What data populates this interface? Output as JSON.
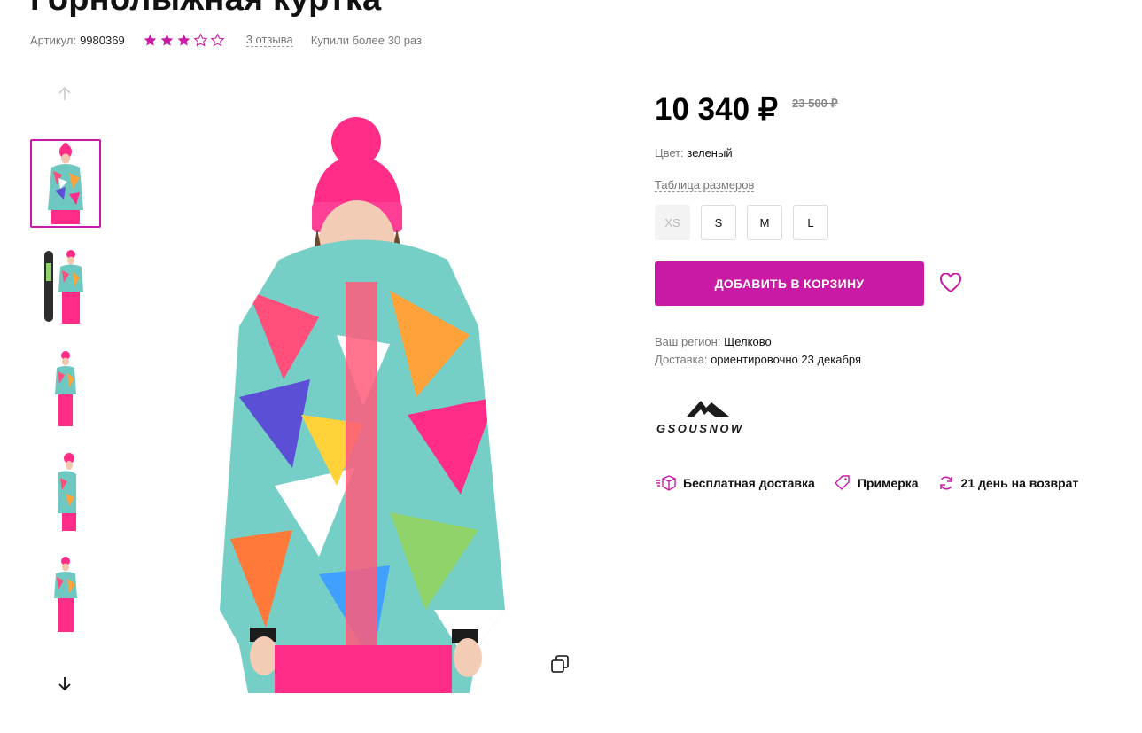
{
  "product": {
    "title": "Горнолыжная куртка",
    "sku_label": "Артикул:",
    "sku_value": "9980369",
    "rating": 3,
    "rating_max": 5,
    "reviews_link": "3 отзыва",
    "bought_text": "Купили более 30 раз"
  },
  "gallery": {
    "thumbnail_count": 5,
    "active_index": 0
  },
  "pricing": {
    "price": "10 340 ₽",
    "old_price": "23 500 ₽"
  },
  "color": {
    "label": "Цвет:",
    "value": "зеленый"
  },
  "sizes": {
    "table_link": "Таблица размеров",
    "options": [
      {
        "label": "XS",
        "available": false
      },
      {
        "label": "S",
        "available": true
      },
      {
        "label": "M",
        "available": true
      },
      {
        "label": "L",
        "available": true
      }
    ]
  },
  "actions": {
    "add_to_cart": "ДОБАВИТЬ В КОРЗИНУ"
  },
  "delivery": {
    "region_label": "Ваш регион:",
    "region_value": "Щелково",
    "delivery_label": "Доставка:",
    "delivery_value": "ориентировочно 23 декабря"
  },
  "brand": {
    "name": "GSOUSNOW"
  },
  "features": [
    {
      "icon": "delivery-box-icon",
      "label": "Бесплатная доставка"
    },
    {
      "icon": "tag-icon",
      "label": "Примерка"
    },
    {
      "icon": "refresh-icon",
      "label": "21 день на возврат"
    }
  ],
  "colors": {
    "accent": "#c81aa4",
    "star_filled": "#c81aa4",
    "text_muted": "#777777"
  }
}
